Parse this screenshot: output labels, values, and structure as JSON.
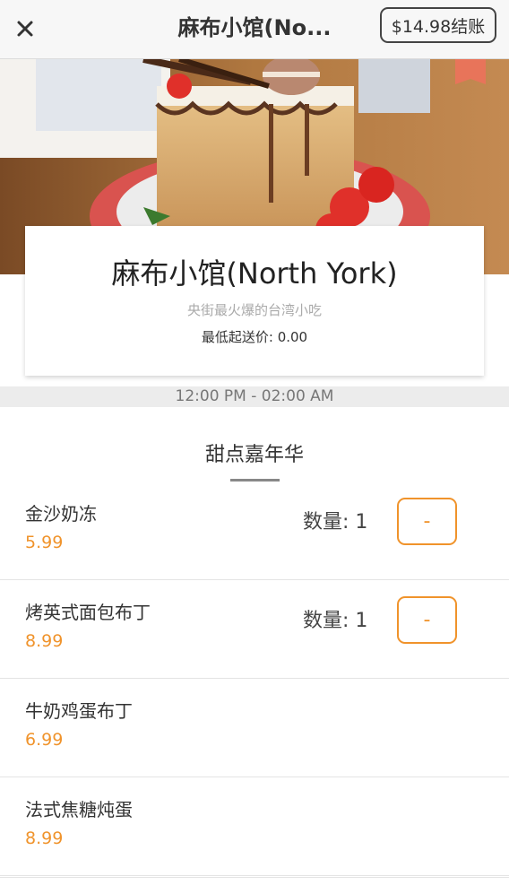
{
  "header": {
    "title": "麻布小馆(No...",
    "checkout_label": "$14.98结账"
  },
  "restaurant": {
    "name": "麻布小馆(North York)",
    "tagline": "央街最火爆的台湾小吃",
    "min_order": "最低起送价: 0.00",
    "hours": "12:00 PM - 02:00 AM"
  },
  "category": {
    "title": "甜点嘉年华"
  },
  "items": [
    {
      "name": "金沙奶冻",
      "price": "5.99",
      "qty_label": "数量: 1",
      "minus_label": "-"
    },
    {
      "name": "烤英式面包布丁",
      "price": "8.99",
      "qty_label": "数量: 1",
      "minus_label": "-"
    },
    {
      "name": "牛奶鸡蛋布丁",
      "price": "6.99"
    },
    {
      "name": "法式焦糖炖蛋",
      "price": "8.99"
    }
  ],
  "colors": {
    "accent": "#f0932b",
    "topbar_bg": "#f7f7f7",
    "hours_bg": "#ececec"
  },
  "icons": {
    "close": "close-icon",
    "bookmark": "bookmark-icon"
  }
}
